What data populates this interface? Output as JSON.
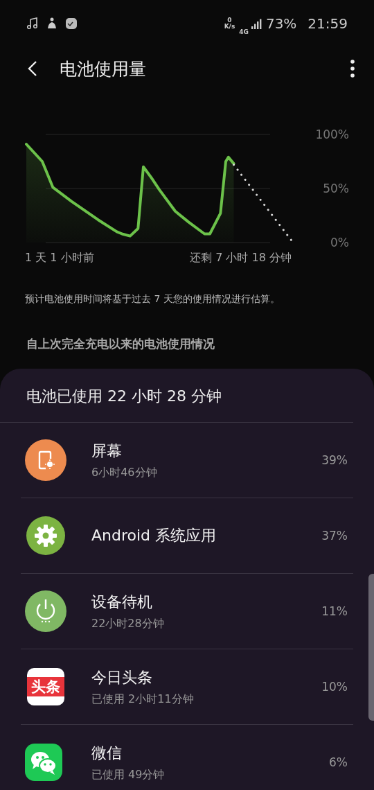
{
  "status_bar": {
    "notifications": [
      {
        "kind": "music"
      },
      {
        "kind": "figure"
      },
      {
        "kind": "check"
      }
    ],
    "net_speed_value": "0",
    "net_speed_unit": "K/s",
    "network": "4G",
    "battery": "73%",
    "time": "21:59"
  },
  "header": {
    "title": "电池使用量"
  },
  "chart": {
    "axis_labels": [
      "100%",
      "50%",
      "0%"
    ],
    "start_label": "1 天 1 小时前",
    "end_label": "还剩 7 小时 18 分钟"
  },
  "note": "预计电池使用时间将基于过去 7 天您的使用情况进行估算。",
  "section_title": "自上次完全充电以来的电池使用情况",
  "usage": {
    "title": "电池已使用 22 小时 28 分钟",
    "items": [
      {
        "kind": "screen",
        "name": "屏幕",
        "detail": "6小时46分钟",
        "percent": "39%"
      },
      {
        "kind": "android",
        "name": "Android 系统应用",
        "percent": "37%"
      },
      {
        "kind": "standby",
        "name": "设备待机",
        "detail": "22小时28分钟",
        "percent": "11%"
      },
      {
        "kind": "toutiao",
        "name": "今日头条",
        "detail": "已使用 2小时11分钟",
        "percent": "10%",
        "badge_text": "头条"
      },
      {
        "kind": "wechat",
        "name": "微信",
        "detail": "已使用 49分钟",
        "percent": "6%"
      }
    ]
  }
}
